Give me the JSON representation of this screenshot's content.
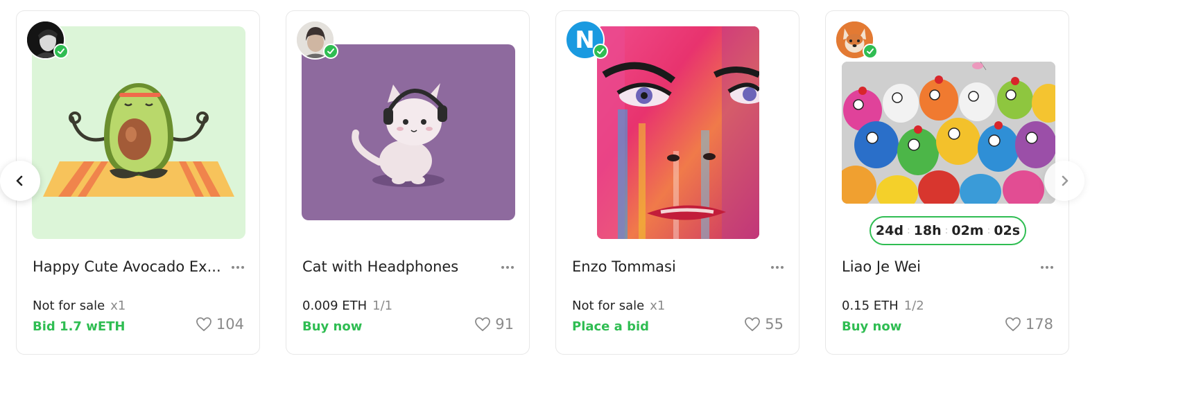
{
  "carousel": {
    "prev_icon": "chevron-left-icon",
    "next_icon": "chevron-right-icon",
    "cards": [
      {
        "creator_icon": "creator-avatar-photo-icon",
        "verified_icon": "check-icon",
        "artwork_icon": "avocado-meditation-illustration",
        "title": "Happy Cute Avocado Ex...",
        "price": "Not for sale",
        "edition": "x1",
        "action": "Bid 1.7 wETH",
        "likes": "104"
      },
      {
        "creator_icon": "creator-avatar-photo-icon",
        "verified_icon": "check-icon",
        "artwork_icon": "cat-headphones-illustration",
        "title": "Cat with Headphones",
        "price": "0.009 ETH",
        "edition": "1/1",
        "action": "Buy now",
        "likes": "91"
      },
      {
        "creator_icon": "letter-n-avatar-icon",
        "creator_letter": "N",
        "verified_icon": "check-icon",
        "artwork_icon": "colorful-face-painting",
        "title": "Enzo Tommasi",
        "price": "Not for sale",
        "edition": "x1",
        "action": "Place a bid",
        "likes": "55"
      },
      {
        "creator_icon": "corgi-avatar-icon",
        "verified_icon": "check-icon",
        "artwork_icon": "colorful-chickens-painting",
        "timer": {
          "days": "24d",
          "hours": "18h",
          "minutes": "02m",
          "seconds": "02s"
        },
        "title": "Liao Je Wei",
        "price": "0.15 ETH",
        "edition": "1/2",
        "action": "Buy now",
        "likes": "178"
      }
    ]
  },
  "colors": {
    "accent_green": "#2fbd52",
    "muted_text": "#8a8a8a",
    "avocado_bg": "#dcf5d8",
    "cat_bg": "#8e6a9e",
    "n_avatar_blue": "#1a9ae0"
  }
}
